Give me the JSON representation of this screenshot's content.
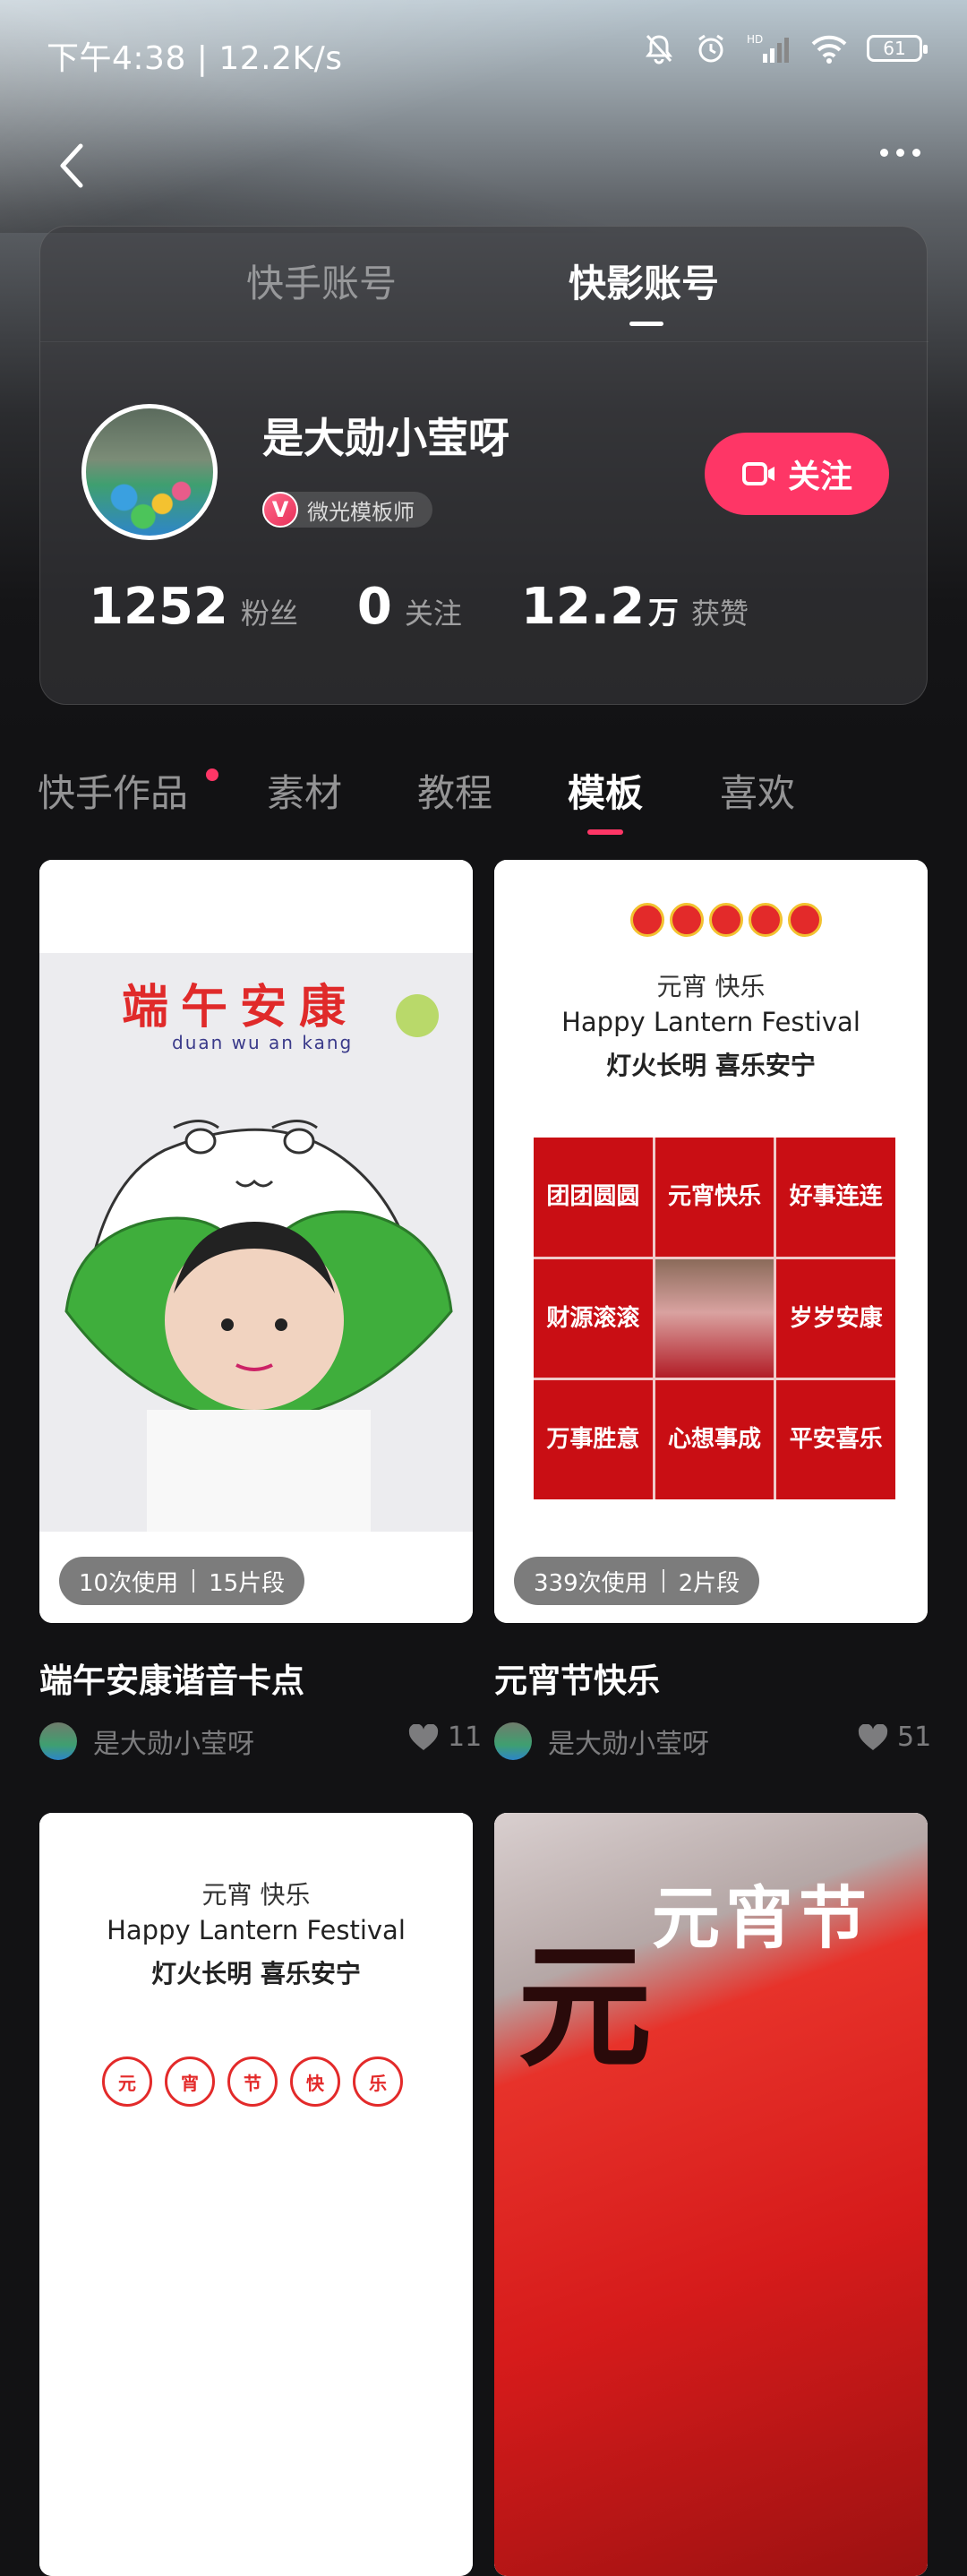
{
  "status_bar": {
    "time": "下午4:38 | 12.2K/s",
    "battery": "61",
    "hd_label": "HD"
  },
  "nav": {
    "back_icon": "chevron-left-icon",
    "more_icon": "more-dots-icon"
  },
  "account_tabs": [
    {
      "label": "快手账号",
      "active": false
    },
    {
      "label": "快影账号",
      "active": true
    }
  ],
  "profile": {
    "name": "是大勋小莹呀",
    "badge_letter": "V",
    "badge_label": "微光模板师",
    "follow_label": "关注",
    "stats": [
      {
        "value": "1252",
        "unit": "",
        "label": "粉丝"
      },
      {
        "value": "0",
        "unit": "",
        "label": "关注"
      },
      {
        "value": "12.2",
        "unit": "万",
        "label": "获赞"
      }
    ]
  },
  "content_tabs": [
    {
      "label": "快手作品",
      "active": false,
      "dot": true
    },
    {
      "label": "素材",
      "active": false
    },
    {
      "label": "教程",
      "active": false
    },
    {
      "label": "模板",
      "active": true
    },
    {
      "label": "喜欢",
      "active": false
    }
  ],
  "colors": {
    "accent": "#fe3666",
    "background": "#121214"
  },
  "templates": [
    {
      "title": "端午安康谐音卡点",
      "uses": "10次使用",
      "segments": "15片段",
      "author": "是大勋小莹呀",
      "likes": "11",
      "thumb_text": {
        "title": "端午安康",
        "pinyin": "duan wu an kang"
      }
    },
    {
      "title": "元宵节快乐",
      "uses": "339次使用",
      "segments": "2片段",
      "author": "是大勋小莹呀",
      "likes": "51",
      "thumb_text": {
        "line1": "元宵  快乐",
        "english": "Happy Lantern Festival",
        "line2": "灯火长明  喜乐安宁",
        "grid": [
          "团团圆圆",
          "元宵快乐",
          "好事连连",
          "财源滚滚",
          "",
          "岁岁安康",
          "万事胜意",
          "心想事成",
          "平安喜乐"
        ]
      }
    },
    {
      "thumb_text": {
        "line1": "元宵  快乐",
        "english": "Happy Lantern Festival",
        "line2": "灯火长明  喜乐安宁",
        "lanterns": [
          "元",
          "宵",
          "节",
          "快",
          "乐"
        ]
      }
    },
    {
      "thumb_text": {
        "title": "元宵节",
        "big": "元"
      }
    }
  ]
}
